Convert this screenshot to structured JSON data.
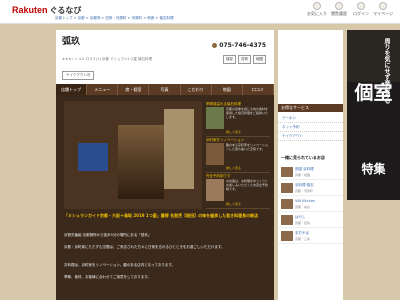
{
  "header": {
    "logo_main": "Rakuten",
    "logo_sub": "ぐるなび",
    "breadcrumbs": "京都トップ > 京都 > 京都府 > 四条・河原町 > 河原町 > 和食 > 懐石料理",
    "nav": [
      {
        "label": "お気に入り",
        "icon": "heart-icon"
      },
      {
        "label": "閲覧履歴",
        "icon": "history-icon"
      },
      {
        "label": "ログイン",
        "icon": "login-icon"
      },
      {
        "label": "マイページ",
        "icon": "user-icon"
      }
    ]
  },
  "shop": {
    "name": "弧玖",
    "meta": "★★★☆☆ 4.0  口コミ(1)  京都 ミシュラン1つ星 懐石料理",
    "tag": "テイクアウト可",
    "tel": "075-746-4375",
    "actions": [
      "保存",
      "共有",
      "地図"
    ]
  },
  "tabs": [
    "店舗トップ",
    "メニュー",
    "席・個室",
    "写真",
    "こだわり",
    "地図",
    "口コミ"
  ],
  "cards": [
    {
      "title": "季節感溢れる懐石料理",
      "body": "京都の四季を感じる旬の素材を使用した懐石料理をご提供いたします。",
      "more": "詳しく見る"
    },
    {
      "title": "京町家をリノベーション",
      "body": "趣のある京町家をリノベーションした落ち着いた空間です。",
      "more": "詳しく見る"
    },
    {
      "title": "完全予約制です",
      "body": "お食事は、お料理をゆっくりとお楽しみいただくため完全予約制です。",
      "more": "詳しく見る"
    }
  ],
  "headline": "「ミシュランガイド京都・大阪＋鳥取 2019 1つ星」獲得 名割烹【桜田】の味を継承した若き料理長の新店",
  "paragraphs": [
    "京割烹番組 京都御所から徒歩5分の場所にある「弧玖」",
    "京都・京町家にたたずむ空間は、ご来店された方々に日常を忘れるひとときをお過ごしいただけます。",
    "お料理は、京町家をリノベーション。趣のある店内となっております。",
    "季節、食材、お客様に合わせてご用意をしております。"
  ],
  "sidebar": {
    "service_title": "お得なサービス",
    "services": [
      "クーポン",
      "ネット予約",
      "テイクアウト"
    ],
    "rec_title": "一緒に見られているお店",
    "recs": [
      {
        "name": "祇園 京料理",
        "area": "京都・祇園"
      },
      {
        "name": "京料理 懐石",
        "area": "京都・河原町"
      },
      {
        "name": "VIN Kitchen",
        "area": "京都・烏丸"
      },
      {
        "name": "はやし",
        "area": "京都・四条"
      },
      {
        "name": "手打そば",
        "area": "京都・三条"
      }
    ]
  },
  "banner": {
    "line1": "周りを気にせず楽しめる",
    "line2": "個室",
    "line3": "特集"
  }
}
